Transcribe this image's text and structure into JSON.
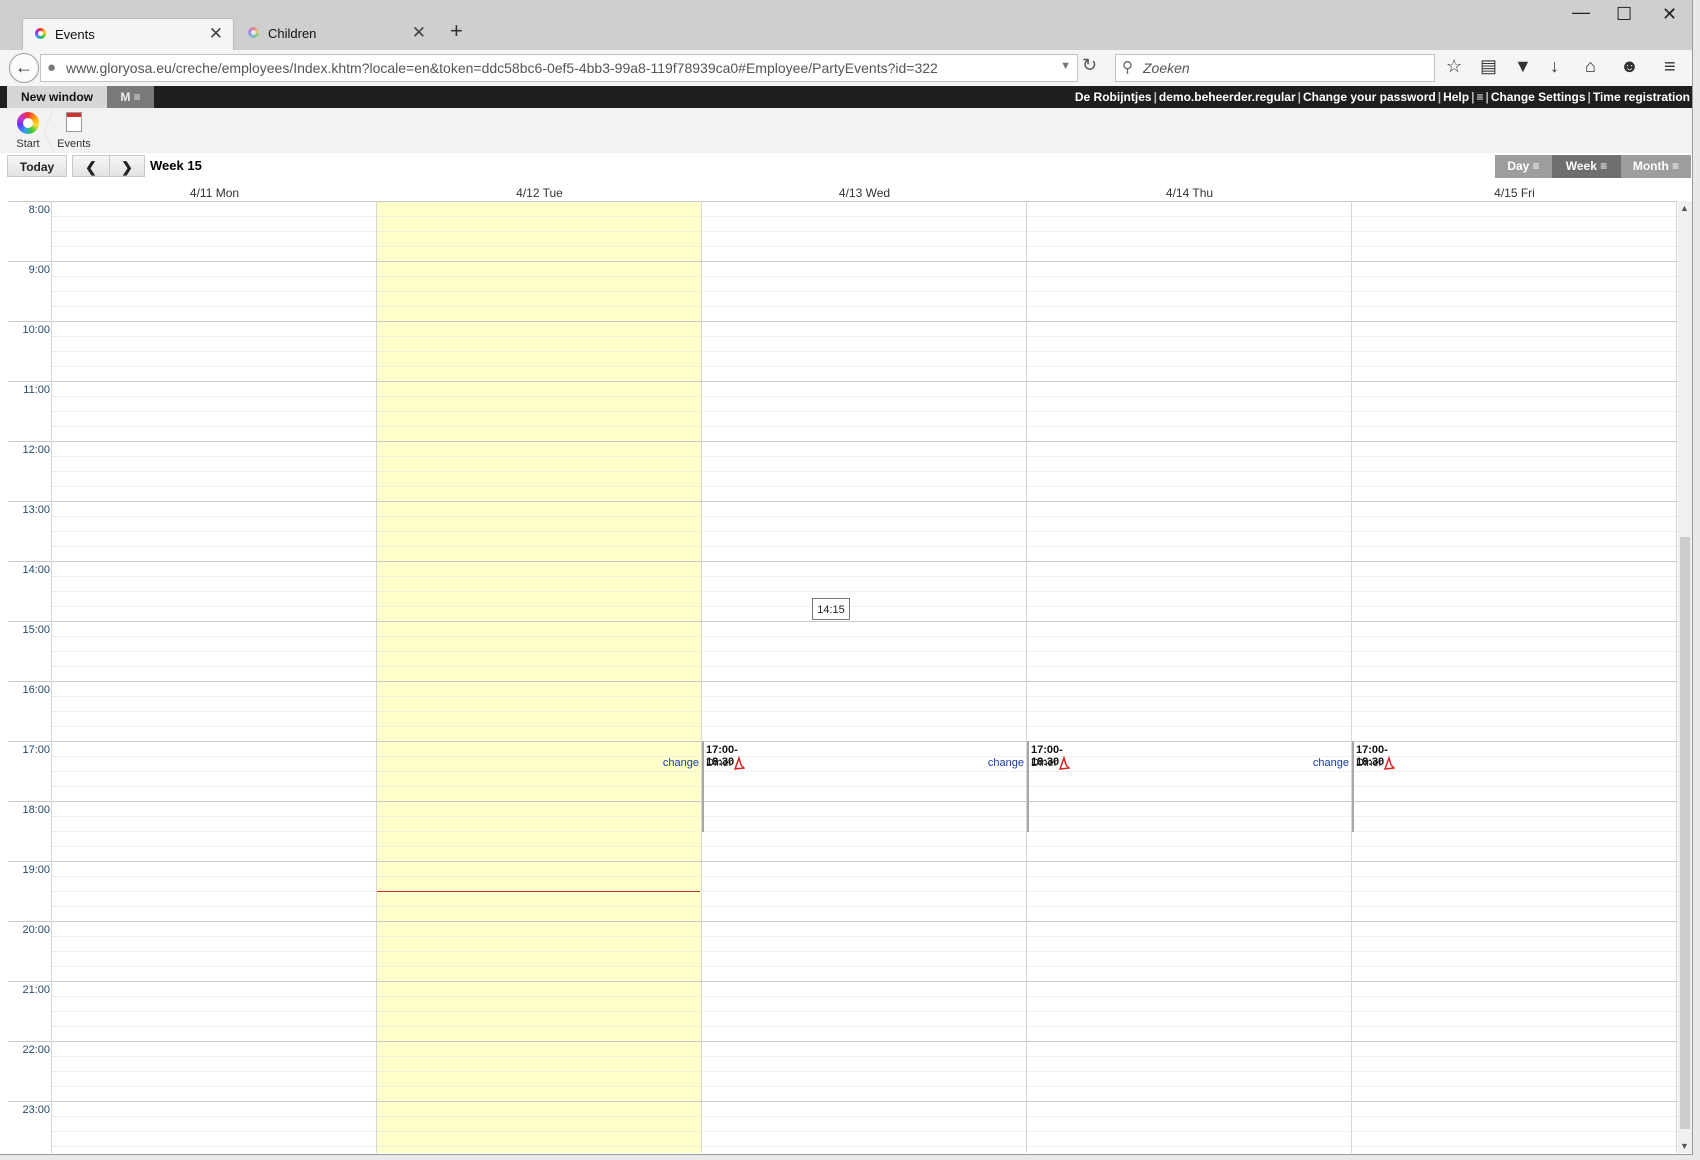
{
  "browser": {
    "tabs": [
      {
        "label": "Events",
        "active": true
      },
      {
        "label": "Children",
        "active": false
      }
    ],
    "new_tab": "+",
    "close_glyph": "✕",
    "url": "www.gloryosa.eu/creche/employees/Index.khtm?locale=en&token=ddc58bc6-0ef5-4bb3-99a8-119f78939ca0#Employee/PartyEvents?id=322",
    "search_placeholder": "Zoeken",
    "window_controls": {
      "minimize": "—",
      "maximize": "☐",
      "close": "✕"
    }
  },
  "appbar": {
    "new_window": "New window",
    "menu_button": "M ≡",
    "right_links": [
      "De Robijntjes",
      "demo.beheerder.regular",
      "Change your password",
      "Help",
      "≡",
      "Change Settings",
      "Time registration"
    ]
  },
  "breadcrumb": {
    "start": "Start",
    "events": "Events"
  },
  "calendar": {
    "today_button": "Today",
    "prev": "❮",
    "next": "❯",
    "week_title": "Week 15",
    "views": [
      "Day ≡",
      "Week ≡",
      "Month ≡"
    ],
    "active_view": "Week ≡",
    "days": [
      "4/11 Mon",
      "4/12 Tue",
      "4/13 Wed",
      "4/14 Thu",
      "4/15 Fri"
    ],
    "today_index": 1,
    "hours": [
      "8:00",
      "9:00",
      "10:00",
      "11:00",
      "12:00",
      "13:00",
      "14:00",
      "15:00",
      "16:00",
      "17:00",
      "18:00",
      "19:00",
      "20:00",
      "21:00",
      "22:00",
      "23:00"
    ],
    "tooltip": "14:15",
    "current_time": "19:30",
    "events": [
      {
        "day": "4/13 Wed",
        "time": "17:00-18:30",
        "title": "Diner",
        "link": "change"
      },
      {
        "day": "4/14 Thu",
        "time": "17:00-18:30",
        "title": "Diner",
        "link": "change"
      },
      {
        "day": "4/15 Fri",
        "time": "17:00-18:30",
        "title": "Diner",
        "link": "change"
      }
    ]
  },
  "colors": {
    "today_bg": "#ffffcc",
    "appbar_bg": "#1f1f1f",
    "link": "#1a3aa8",
    "now_line": "#c03030"
  }
}
